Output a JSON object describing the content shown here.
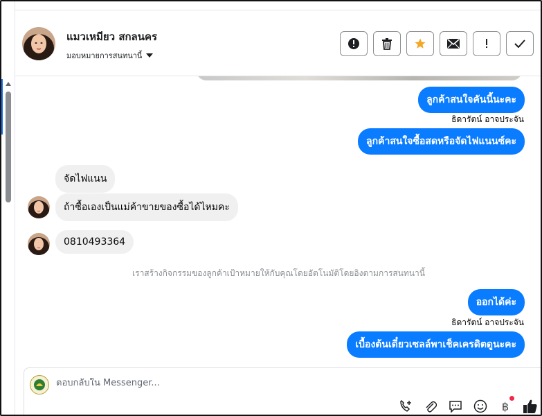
{
  "header": {
    "contact_name": "แมวเหมียว สกลนคร",
    "assign_label": "มอบหมายการสนทนานี้",
    "actions": [
      {
        "name": "spam",
        "icon": "alert-circle-icon"
      },
      {
        "name": "delete",
        "icon": "trash-icon"
      },
      {
        "name": "star",
        "icon": "star-icon"
      },
      {
        "name": "mark-unread",
        "icon": "envelope-icon"
      },
      {
        "name": "follow-up",
        "icon": "exclamation-icon"
      },
      {
        "name": "mark-done",
        "icon": "check-icon"
      }
    ]
  },
  "messages": [
    {
      "dir": "out",
      "text": "ลูกค้าสนใจคันนี้นะคะ"
    },
    {
      "sender": "ธิดารัตน์ อาจประจัน"
    },
    {
      "dir": "out",
      "text": "ลูกค้าสนใจซื้อสดหรือจัดไฟแนนซ์คะ"
    },
    {
      "dir": "in",
      "text": "จัดไฟแนน"
    },
    {
      "dir": "in",
      "text": "ถ้าซื้อเองเป็นแม่ค้าขายของซื้อได้ไหมคะ"
    },
    {
      "dir": "in",
      "text": "0810493364"
    },
    {
      "system": "เราสร้างกิจกรรมของลูกค้าเป้าหมายให้กับคุณโดยอัตโนมัติโดยอิงตามการสนทนานี้"
    },
    {
      "dir": "out",
      "text": "ออกได้ค่ะ"
    },
    {
      "sender": "ธิดารัตน์ อาจประจัน"
    },
    {
      "dir": "out",
      "text": "เบื้องต้นเดี๋ยวเซลล์พาเช็คเครดิตดูนะคะ"
    }
  ],
  "composer": {
    "placeholder": "ตอบกลับใน Messenger...",
    "baht_symbol": "฿",
    "tools": [
      "call-add-icon",
      "paperclip-icon",
      "saved-reply-icon",
      "emoji-icon",
      "baht-icon",
      "thumbs-up-icon"
    ]
  },
  "colors": {
    "outgoing_bubble": "#0a7cff",
    "incoming_bubble": "#f0f0f0",
    "star": "#f5a623",
    "system_text": "#8a8d91"
  }
}
